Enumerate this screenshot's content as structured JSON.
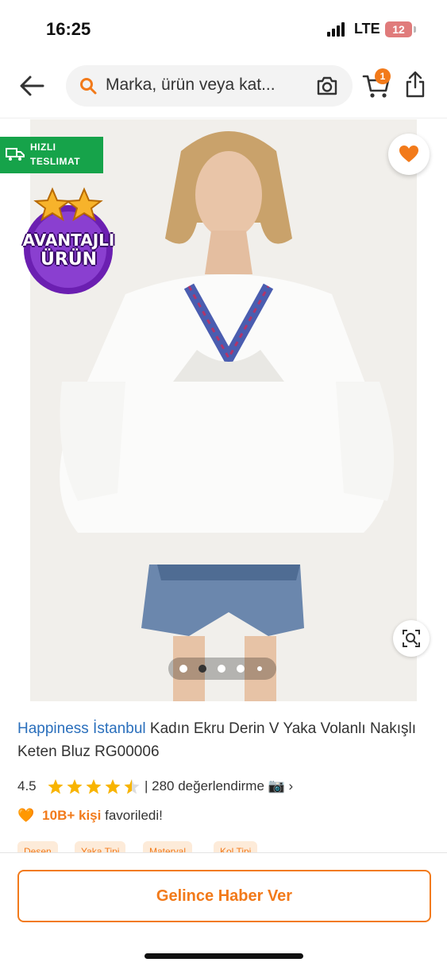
{
  "status_bar": {
    "time": "16:25",
    "network": "LTE",
    "battery": "12"
  },
  "search": {
    "placeholder": "Marka, ürün veya kat..."
  },
  "cart": {
    "count": "1"
  },
  "badges": {
    "fast_line1": "HIZLI",
    "fast_line2": "TESLIMAT",
    "advantage_line1": "AVANTAJLI",
    "advantage_line2": "ÜRÜN"
  },
  "gallery": {
    "image_count": 5,
    "active_index": 1
  },
  "product": {
    "brand": "Happiness İstanbul",
    "name": "Kadın Ekru Derin V Yaka Volanlı Nakışlı Keten Bluz RG00006",
    "rating": "4.5",
    "rating_value": 4.5,
    "review_count": "| 280 değerlendirme",
    "favorites_count": "10B+ kişi",
    "favorites_suffix": "favoriledi!"
  },
  "chips": [
    "Desen",
    "Yaka Tipi",
    "Materyal",
    "Kol Tipi"
  ],
  "actions": {
    "notify_label": "Gelince Haber Ver"
  },
  "colors": {
    "accent": "#f27a1a",
    "brand_link": "#2a6fbc",
    "fast_delivery": "#16a34a",
    "advantage_badge": "#6b1fb1"
  },
  "icons": [
    "back-arrow-icon",
    "search-icon",
    "camera-icon",
    "cart-icon",
    "share-icon",
    "heart-icon",
    "truck-icon",
    "star-icon",
    "visual-search-icon"
  ]
}
